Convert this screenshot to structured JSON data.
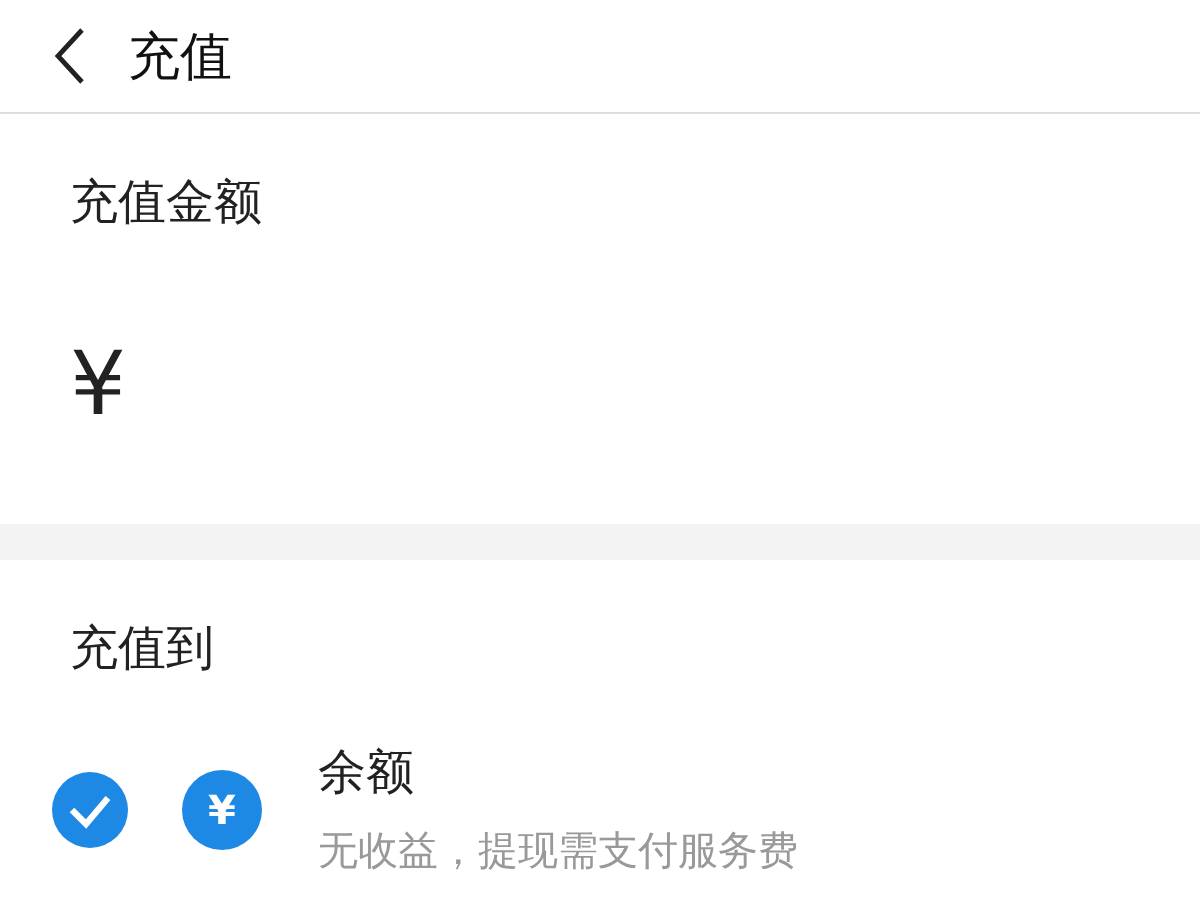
{
  "header": {
    "title": "充值"
  },
  "amount": {
    "label": "充值金额",
    "currency": "¥"
  },
  "target": {
    "label": "充值到",
    "options": [
      {
        "title": "余额",
        "subtitle": "无收益，提现需支付服务费",
        "icon": "¥",
        "selected": true
      }
    ]
  }
}
